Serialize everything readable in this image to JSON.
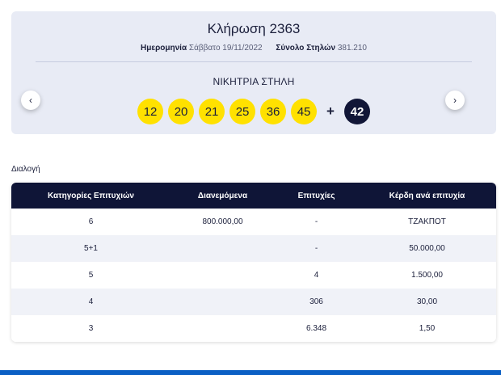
{
  "draw": {
    "title": "Κλήρωση 2363",
    "date_label": "Ημερομηνία",
    "date_value": "Σάββατο 19/11/2022",
    "columns_label": "Σύνολο Στηλών",
    "columns_value": "381.210",
    "winning_label": "ΝΙΚΗΤΡΙΑ ΣΤΗΛΗ",
    "numbers": [
      "12",
      "20",
      "21",
      "25",
      "36",
      "45"
    ],
    "plus": "+",
    "bonus": "42",
    "prev_symbol": "‹",
    "next_symbol": "›"
  },
  "caption": "Διαλογή",
  "table": {
    "headers": [
      "Κατηγορίες Επιτυχιών",
      "Διανεμόμενα",
      "Επιτυχίες",
      "Κέρδη ανά επιτυχία"
    ],
    "rows": [
      [
        "6",
        "800.000,00",
        "-",
        "ΤΖΑΚΠΟΤ"
      ],
      [
        "5+1",
        "",
        "-",
        "50.000,00"
      ],
      [
        "5",
        "",
        "4",
        "1.500,00"
      ],
      [
        "4",
        "",
        "306",
        "30,00"
      ],
      [
        "3",
        "",
        "6.348",
        "1,50"
      ]
    ]
  },
  "colors": {
    "ball": "#ffe100",
    "bonus_ball": "#111637",
    "header_bg": "#0f1537",
    "card_bg": "#e8ebf5",
    "accent_bar": "#0b5fc4"
  }
}
